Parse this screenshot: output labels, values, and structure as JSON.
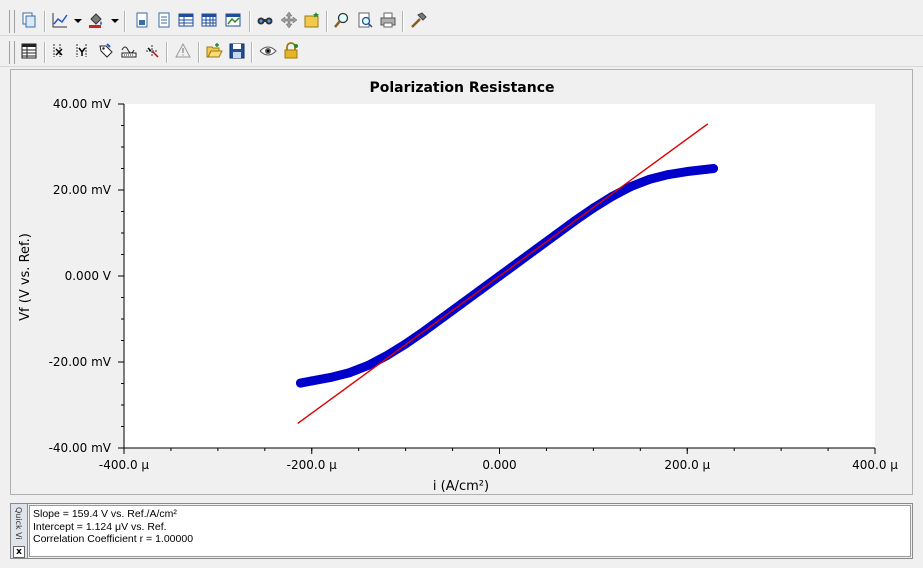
{
  "toolbar1": {
    "buttons": [
      "copy-icon",
      "chart-type-icon",
      "color-fill-icon",
      "page-icon",
      "page-lines-icon",
      "table-icon",
      "grid-icon",
      "chart-window-icon",
      "binoculars-icon",
      "move-icon",
      "folder-star-icon",
      "zoom-icon",
      "print-preview-icon",
      "printer-icon",
      "hammer-icon"
    ]
  },
  "toolbar2": {
    "buttons": [
      "data-table-icon",
      "cursor-x-icon",
      "cursor-y-icon",
      "tag-icon",
      "baseline-icon",
      "cursor-select-icon",
      "warning-icon",
      "open-folder-icon",
      "save-icon",
      "eye-icon",
      "lock-icon"
    ]
  },
  "chart_data": {
    "type": "scatter",
    "title": "Polarization Resistance",
    "xlabel": "i (A/cm²)",
    "ylabel": "Vf (V vs. Ref.)",
    "xlim": [
      -0.0004,
      0.0004
    ],
    "ylim": [
      -0.04,
      0.04
    ],
    "x_tick_values": [
      -0.0004,
      -0.0002,
      0,
      0.0002,
      0.0004
    ],
    "x_tick_labels": [
      "-400.0 μ",
      "-200.0 μ",
      "0.000",
      "200.0 μ",
      "400.0 μ"
    ],
    "y_tick_values": [
      0.04,
      0.02,
      0,
      -0.02,
      -0.04
    ],
    "y_tick_labels": [
      "40.00 mV",
      "20.00 mV",
      "0.000 V",
      "-20.00 mV",
      "-40.00 mV"
    ],
    "series": [
      {
        "kind": "scatter",
        "color": "#0000cc",
        "x": [
          -0.000212,
          -0.0002,
          -0.00018,
          -0.00016,
          -0.00014,
          -0.00012,
          -0.0001,
          -8e-05,
          -6e-05,
          -4e-05,
          -2e-05,
          0,
          2e-05,
          4e-05,
          6e-05,
          8e-05,
          0.0001,
          0.00012,
          0.00014,
          0.00016,
          0.00018,
          0.0002,
          0.00022,
          0.000228
        ],
        "y": [
          -0.0249,
          -0.0244,
          -0.0236,
          -0.0225,
          -0.0208,
          -0.0185,
          -0.0158,
          -0.0128,
          -0.0096,
          -0.0064,
          -0.0032,
          0.0,
          0.0032,
          0.0064,
          0.0096,
          0.0128,
          0.0158,
          0.0185,
          0.0208,
          0.0225,
          0.0236,
          0.0243,
          0.0248,
          0.025
        ]
      },
      {
        "kind": "line",
        "color": "#dd0000",
        "x": [
          -0.000215,
          0.000222
        ],
        "y": [
          -0.0343,
          0.0354
        ]
      }
    ],
    "grid": false,
    "legend": "none"
  },
  "quick_view": {
    "label": "Quick Vi",
    "close": "x"
  },
  "results": {
    "lines": [
      "Slope = 159.4 V vs. Ref./A/cm²",
      "Intercept = 1.124 μV vs. Ref.",
      "Correlation Coefficient r = 1.00000"
    ]
  }
}
